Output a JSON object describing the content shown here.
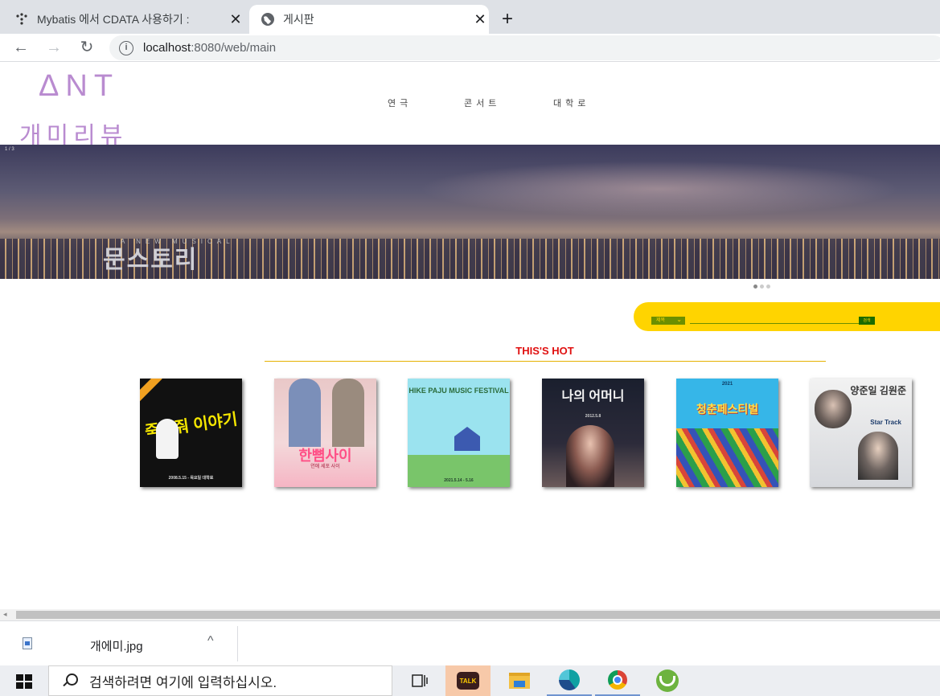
{
  "browser": {
    "tabs": [
      {
        "title": "Mybatis 에서 CDATA 사용하기 :",
        "active": false,
        "favicon": "mybatis-dots-icon"
      },
      {
        "title": "게시판",
        "active": true,
        "favicon": "globe-icon"
      }
    ],
    "new_tab": "+",
    "close_glyph": "✕",
    "url_host": "localhost",
    "url_path": ":8080/web/main",
    "back": "←",
    "forward": "→",
    "reload": "↻",
    "info": "i"
  },
  "site": {
    "logo_en": "ΔNT",
    "logo_kr": "개미리뷰",
    "nav": [
      "연극",
      "콘서트",
      "대학로"
    ],
    "banner": {
      "counter": "1 / 3",
      "subtitle": "A NEW MUSICAL",
      "title": "문스토리"
    },
    "search": {
      "select_label": "제목",
      "button_label": "검색"
    },
    "hot_title": "THIS'S HOT",
    "posters": [
      {
        "title": "죽여줘 이야기",
        "caption": "2008.5.15 - 목요일 대학로"
      },
      {
        "title": "한뼘사이",
        "caption": "연애 세포 사이"
      },
      {
        "title": "HIKE PAJU MUSIC FESTIVAL",
        "caption": "2021.5.14 - 5.16"
      },
      {
        "title": "나의 어머니",
        "caption": "2012.5.8"
      },
      {
        "title": "청춘페스티벌",
        "caption": "2021"
      },
      {
        "title": "양준일 김원준",
        "caption": "Star Track"
      }
    ]
  },
  "download": {
    "filename": "개에미.jpg",
    "chevron": "^"
  },
  "taskbar": {
    "search_placeholder": "검색하려면 여기에 입력하십시오.",
    "kakao_label": "TALK"
  },
  "colors": {
    "accent_purple": "#b98bd0",
    "search_yellow": "#ffd400",
    "hot_red": "#e01010"
  }
}
